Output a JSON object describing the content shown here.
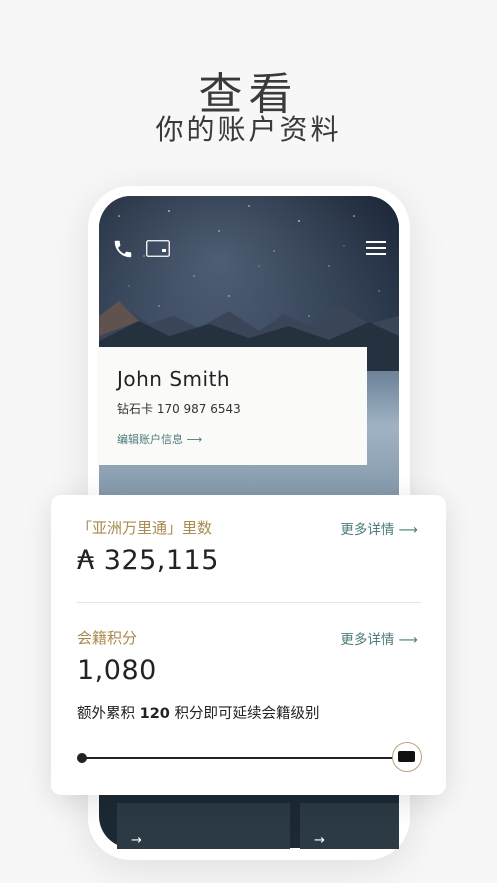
{
  "header": {
    "title": "查看",
    "subtitle": "你的账户资料"
  },
  "app": {
    "topbar": {
      "phone_icon": "phone-icon",
      "card_icon": "card-icon",
      "menu_icon": "menu-icon"
    },
    "profile": {
      "name": "John Smith",
      "tier_line": "钻石卡  170 987 6543",
      "edit_link": "编辑账户信息 ⟶"
    },
    "miles": {
      "label": "「亚洲万里通」里数",
      "more": "更多详情 ⟶",
      "value": "₳ 325,115"
    },
    "membership": {
      "label": "会籍积分",
      "more": "更多详情 ⟶",
      "value": "1,080",
      "extra_prefix": "额外累积 ",
      "extra_number": "120",
      "extra_suffix": " 积分即可延续会籍级别",
      "progress_fraction": 0.96
    },
    "bottom_tiles": {
      "arrow": "→"
    }
  },
  "colors": {
    "accent_gold": "#a98a4f",
    "link_teal": "#4b7c7a",
    "background": "#f7f7f7"
  }
}
